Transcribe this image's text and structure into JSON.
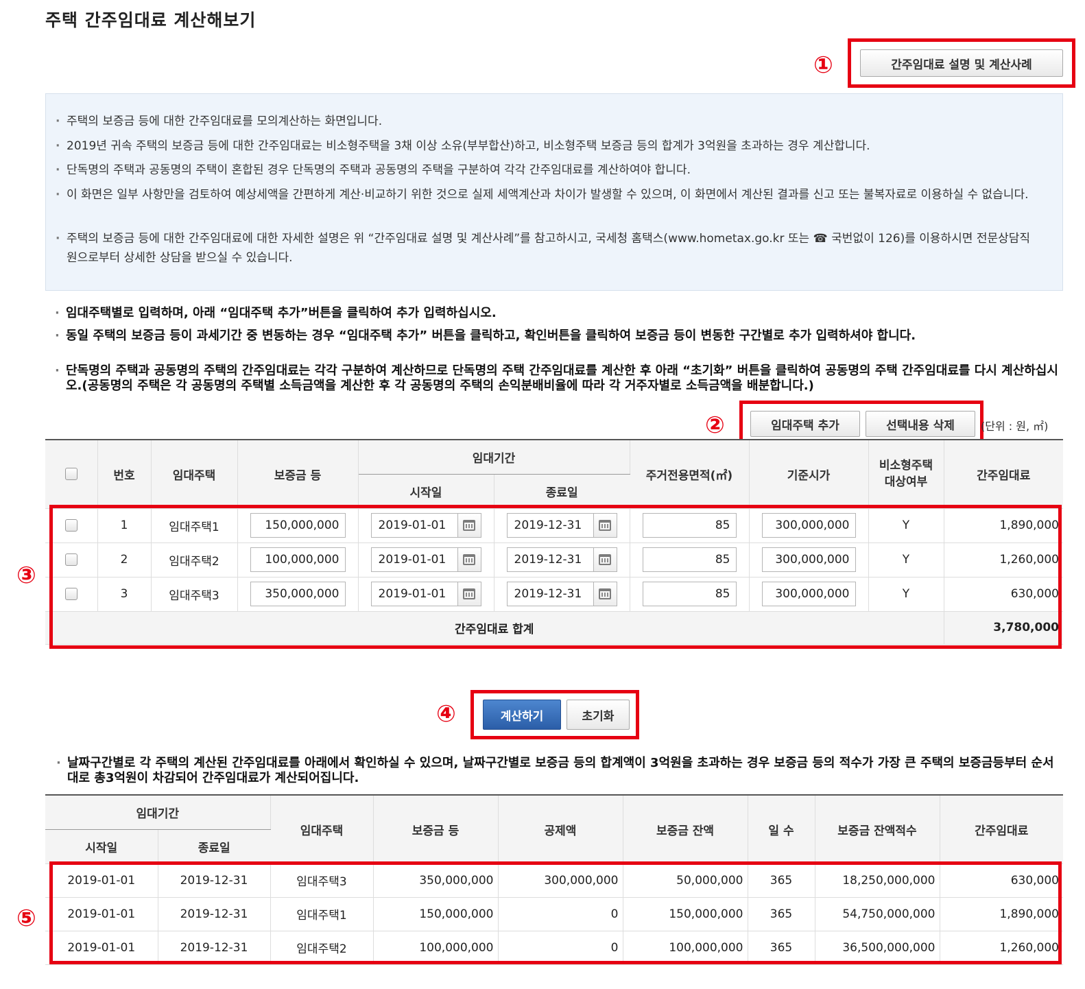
{
  "page_title": "주택 간주임대료 계산해보기",
  "explain_button_label": "간주임대료 설명 및 계산사례",
  "markers": [
    "①",
    "②",
    "③",
    "④",
    "⑤"
  ],
  "info_lines": [
    "주택의 보증금 등에 대한 간주임대료를 모의계산하는 화면입니다.",
    "2019년 귀속 주택의 보증금 등에 대한 간주임대료는 비소형주택을 3채 이상 소유(부부합산)하고, 비소형주택 보증금 등의 합계가 3억원을 초과하는 경우 계산합니다.",
    "단독명의 주택과 공동명의 주택이 혼합된 경우 단독명의 주택과 공동명의 주택을 구분하여 각각 간주임대료를 계산하여야 합니다.",
    "이 화면은 일부 사항만을 검토하여 예상세액을 간편하게 계산·비교하기 위한 것으로 실제 세액계산과 차이가 발생할 수 있으며, 이 화면에서 계산된 결과를 신고 또는 불복자료로 이용하실 수 없습니다.",
    "주택의 보증금 등에 대한 간주임대료에 대한 자세한 설명은 위 “간주임대료 설명 및 계산사례”를 참고하시고, 국세청 홈택스(www.hometax.go.kr 또는 ☎ 국번없이 126)를 이용하시면 전문상담직원으로부터 상세한 상담을 받으실 수 있습니다."
  ],
  "notes": [
    "임대주택별로 입력하며, 아래 “임대주택 추가”버튼을 클릭하여 추가 입력하십시오.",
    "동일 주택의 보증금 등이 과세기간 중 변동하는 경우 “임대주택 추가” 버튼을 클릭하고, 확인버튼을 클릭하여 보증금 등이 변동한 구간별로 추가 입력하셔야 합니다.",
    "단독명의 주택과 공동명의 주택의 간주임대료는 각각 구분하여 계산하므로 단독명의 주택 간주임대료를 계산한 후 아래 “초기화” 버튼을 클릭하여 공동명의 주택 간주임대료를 다시 계산하십시오.(공동명의 주택은 각 공동명의 주택별 소득금액을 계산한 후 각 공동명의 주택의 손익분배비율에 따라 각 거주자별로 소득금액을 배분합니다.)"
  ],
  "add_button_label": "임대주택 추가",
  "delete_button_label": "선택내용 삭제",
  "unit_label": "(단위 : 원, ㎡)",
  "input_table": {
    "headers": {
      "no": "번호",
      "house": "임대주택",
      "deposit": "보증금 등",
      "period": "임대기간",
      "start": "시작일",
      "end": "종료일",
      "area": "주거전용면적(㎡)",
      "price": "기준시가",
      "nonsmall_line1": "비소형주택",
      "nonsmall_line2": "대상여부",
      "rent": "간주임대료"
    },
    "rows": [
      {
        "no": "1",
        "house": "임대주택1",
        "deposit": "150,000,000",
        "start": "2019-01-01",
        "end": "2019-12-31",
        "area": "85",
        "price": "300,000,000",
        "nonsmall": "Y",
        "rent": "1,890,000"
      },
      {
        "no": "2",
        "house": "임대주택2",
        "deposit": "100,000,000",
        "start": "2019-01-01",
        "end": "2019-12-31",
        "area": "85",
        "price": "300,000,000",
        "nonsmall": "Y",
        "rent": "1,260,000"
      },
      {
        "no": "3",
        "house": "임대주택3",
        "deposit": "350,000,000",
        "start": "2019-01-01",
        "end": "2019-12-31",
        "area": "85",
        "price": "300,000,000",
        "nonsmall": "Y",
        "rent": "630,000"
      }
    ],
    "total_label": "간주임대료 합계",
    "total_value": "3,780,000"
  },
  "calc_button_label": "계산하기",
  "reset_button_label": "초기화",
  "result_note": "날짜구간별로 각 주택의 계산된 간주임대료를 아래에서 확인하실 수 있으며, 날짜구간별로 보증금 등의 합계액이 3억원을 초과하는 경우 보증금 등의 적수가 가장 큰 주택의 보증금등부터 순서대로 총3억원이 차감되어 간주임대료가 계산되어집니다.",
  "result_table": {
    "headers": {
      "period": "임대기간",
      "start": "시작일",
      "end": "종료일",
      "house": "임대주택",
      "deposit": "보증금 등",
      "deduction": "공제액",
      "balance": "보증금 잔액",
      "days": "일 수",
      "balance_sum": "보증금 잔액적수",
      "rent": "간주임대료"
    },
    "rows": [
      {
        "start": "2019-01-01",
        "end": "2019-12-31",
        "house": "임대주택3",
        "deposit": "350,000,000",
        "deduction": "300,000,000",
        "balance": "50,000,000",
        "days": "365",
        "balance_sum": "18,250,000,000",
        "rent": "630,000"
      },
      {
        "start": "2019-01-01",
        "end": "2019-12-31",
        "house": "임대주택1",
        "deposit": "150,000,000",
        "deduction": "0",
        "balance": "150,000,000",
        "days": "365",
        "balance_sum": "54,750,000,000",
        "rent": "1,890,000"
      },
      {
        "start": "2019-01-01",
        "end": "2019-12-31",
        "house": "임대주택2",
        "deposit": "100,000,000",
        "deduction": "0",
        "balance": "100,000,000",
        "days": "365",
        "balance_sum": "36,500,000,000",
        "rent": "1,260,000"
      }
    ]
  },
  "colors": {
    "highlight": "#e60012",
    "primary": "#2b5ea8",
    "info_bg": "#eef4fb"
  }
}
